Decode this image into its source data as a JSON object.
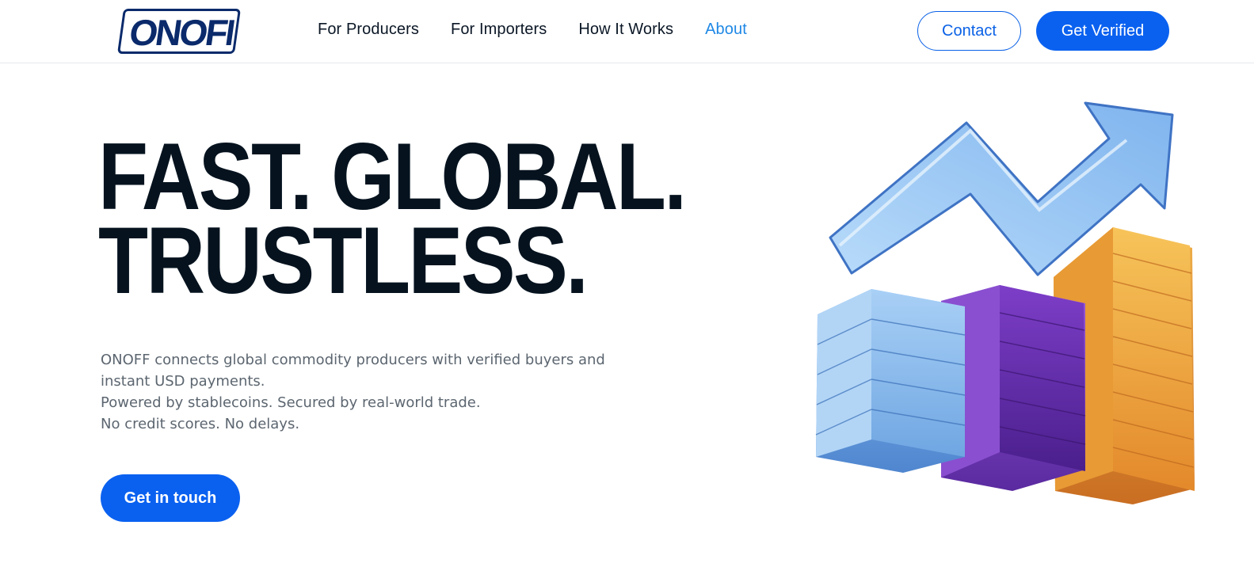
{
  "header": {
    "logo_text": "ONOFF",
    "nav": [
      {
        "label": "For Producers",
        "active": false
      },
      {
        "label": "For Importers",
        "active": false
      },
      {
        "label": "How It Works",
        "active": false
      },
      {
        "label": "About",
        "active": true
      }
    ],
    "contact_label": "Contact",
    "verify_label": "Get Verified"
  },
  "hero": {
    "title_line1": "FAST. GLOBAL.",
    "title_line2": "TRUSTLESS.",
    "desc_line1": "ONOFF connects global commodity producers with verified buyers and",
    "desc_line2": "instant USD payments.",
    "desc_line3": "Powered by stablecoins. Secured by real-world trade.",
    "desc_line4": "No credit scores. No delays.",
    "cta_label": "Get in touch"
  },
  "illustration": {
    "icon": "growth-chart-illustration",
    "colors": {
      "bar1": "#8ec0f0",
      "bar2": "#7a3dc4",
      "bar3": "#f2a53a",
      "arrow": "#a9cff5"
    }
  },
  "colors": {
    "accent": "#0a61f0",
    "active_nav": "#1e88e5",
    "headline": "#06131f",
    "body_text": "#5c6670"
  }
}
